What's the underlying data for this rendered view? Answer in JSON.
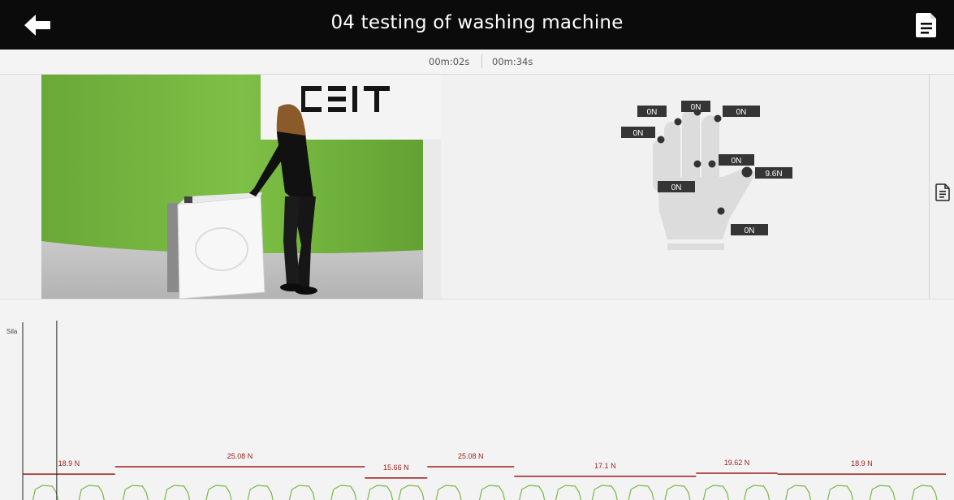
{
  "header": {
    "title": "04 testing of washing machine"
  },
  "playback": {
    "current_time": "00m:02s",
    "total_time": "00m:34s"
  },
  "video": {
    "logo_text": "CEIT"
  },
  "glove": {
    "readings": [
      "0N",
      "0N",
      "0N",
      "0N",
      "0N",
      "9.6N",
      "0N",
      "0N"
    ]
  },
  "chart_data": {
    "type": "line",
    "ylabel": "Sila",
    "cursor_time_s": 2,
    "duration_s": 34,
    "segments": [
      {
        "label": "18.9 N",
        "value": 18.9,
        "start_s": 0.0,
        "end_s": 3.4
      },
      {
        "label": "25.08 N",
        "value": 25.08,
        "start_s": 3.4,
        "end_s": 12.6
      },
      {
        "label": "15.66 N",
        "value": 15.66,
        "start_s": 12.6,
        "end_s": 14.9
      },
      {
        "label": "25.08 N",
        "value": 25.08,
        "start_s": 14.9,
        "end_s": 18.1
      },
      {
        "label": "17.1 N",
        "value": 17.1,
        "start_s": 18.1,
        "end_s": 24.8
      },
      {
        "label": "19.62 N",
        "value": 19.62,
        "start_s": 24.8,
        "end_s": 27.8
      },
      {
        "label": "18.9 N",
        "value": 18.9,
        "start_s": 27.8,
        "end_s": 34.0
      }
    ],
    "colors": {
      "threshold": "#9b1c1c",
      "signal": "#7ab648",
      "cursor": "#222222"
    }
  },
  "colors": {
    "header_bg": "#0b0b0b",
    "screen_bg": "#f3f3f3",
    "green_screen": "#72b83a"
  },
  "icons": {
    "back": "arrow-left-icon",
    "report": "document-icon"
  }
}
